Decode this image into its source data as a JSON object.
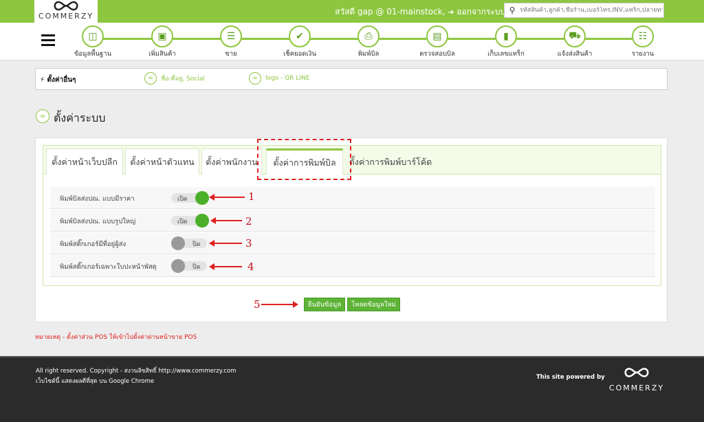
{
  "header": {
    "logo_text": "COMMERZY",
    "greeting": "สวัสดี gap @ 01-mainstock,",
    "logout": "ออกจากระบบ",
    "search_placeholder": "รหัสสินค้า,ลูกค้า,ชื่อร้าน,เบอร์โทร,INV,แทร็ก,ปลายทาง"
  },
  "nav": {
    "items": [
      {
        "label": "ข้อมูลพื้นฐาน",
        "icon": "database-icon"
      },
      {
        "label": "เพิ่มสินค้า",
        "icon": "box-icon"
      },
      {
        "label": "ขาย",
        "icon": "cart-icon"
      },
      {
        "label": "เช็คยอดเงิน",
        "icon": "check-icon"
      },
      {
        "label": "พิมพ์บิล",
        "icon": "printer-icon"
      },
      {
        "label": "ตรวจสอบบิล",
        "icon": "scanner-icon"
      },
      {
        "label": "เก็บเลขแทร็ก",
        "icon": "barcode-icon"
      },
      {
        "label": "แจ้งส่งสินค้า",
        "icon": "truck-icon"
      },
      {
        "label": "รายงาน",
        "icon": "report-icon"
      }
    ]
  },
  "settings_bar": {
    "title": "ตั้งค่าอื่นๆ",
    "links": [
      "ชื่อ-ที่อยู่, Social",
      "logo - QR LINE"
    ]
  },
  "page": {
    "title": "ตั้งค่าระบบ"
  },
  "tabs": [
    {
      "label": "ตั้งค่าหน้าเว็บปลีก",
      "active": false
    },
    {
      "label": "ตั้งค่าหน้าตัวแทน",
      "active": false
    },
    {
      "label": "ตั้งค่าพนักงาน",
      "active": false
    },
    {
      "label": "ตั้งค่าการพิมพ์บิล",
      "active": true
    },
    {
      "label": "ตั้งค่าการพิมพ์บาร์โค้ด",
      "active": false
    }
  ],
  "settings_rows": [
    {
      "label": "พิมพ์บิลส่งปณ. แบบมีราคา",
      "state": "on",
      "state_text": "เปิด"
    },
    {
      "label": "พิมพ์บิลส่งปณ. แบบรูปใหญ่",
      "state": "on",
      "state_text": "เปิด"
    },
    {
      "label": "พิมพ์สติ๊กเกอร์มีที่อยู่ผู้ส่ง",
      "state": "off",
      "state_text": "ปิด"
    },
    {
      "label": "พิมพ์สติ๊กเกอร์เฉพาะใบปะหน้าพัสดุ",
      "state": "off",
      "state_text": "ปิด"
    }
  ],
  "annotations": [
    "1",
    "2",
    "3",
    "4",
    "5"
  ],
  "buttons": {
    "save": "ยืนยันข้อมูล",
    "reload": "โหลดข้อมูลใหม่"
  },
  "note": "หมายเหตุ - ตั้งค่าส่วน POS ให้เข้าไปตั้งค่าผ่านหน้าขาย POS",
  "footer": {
    "copyright": "All right reserved. Copyright - สงวนลิขสิทธิ์ http://www.commerzy.com",
    "browser": "เว็บไซต์นี้ แสดงผลดีที่สุด บน Google Chrome",
    "powered": "This site powered by",
    "logo_text": "COMMERZY"
  },
  "colors": {
    "brand_green": "#8dc63f",
    "toggle_on": "#4caf2a",
    "toggle_off": "#999999",
    "annotation_red": "#e02020"
  }
}
